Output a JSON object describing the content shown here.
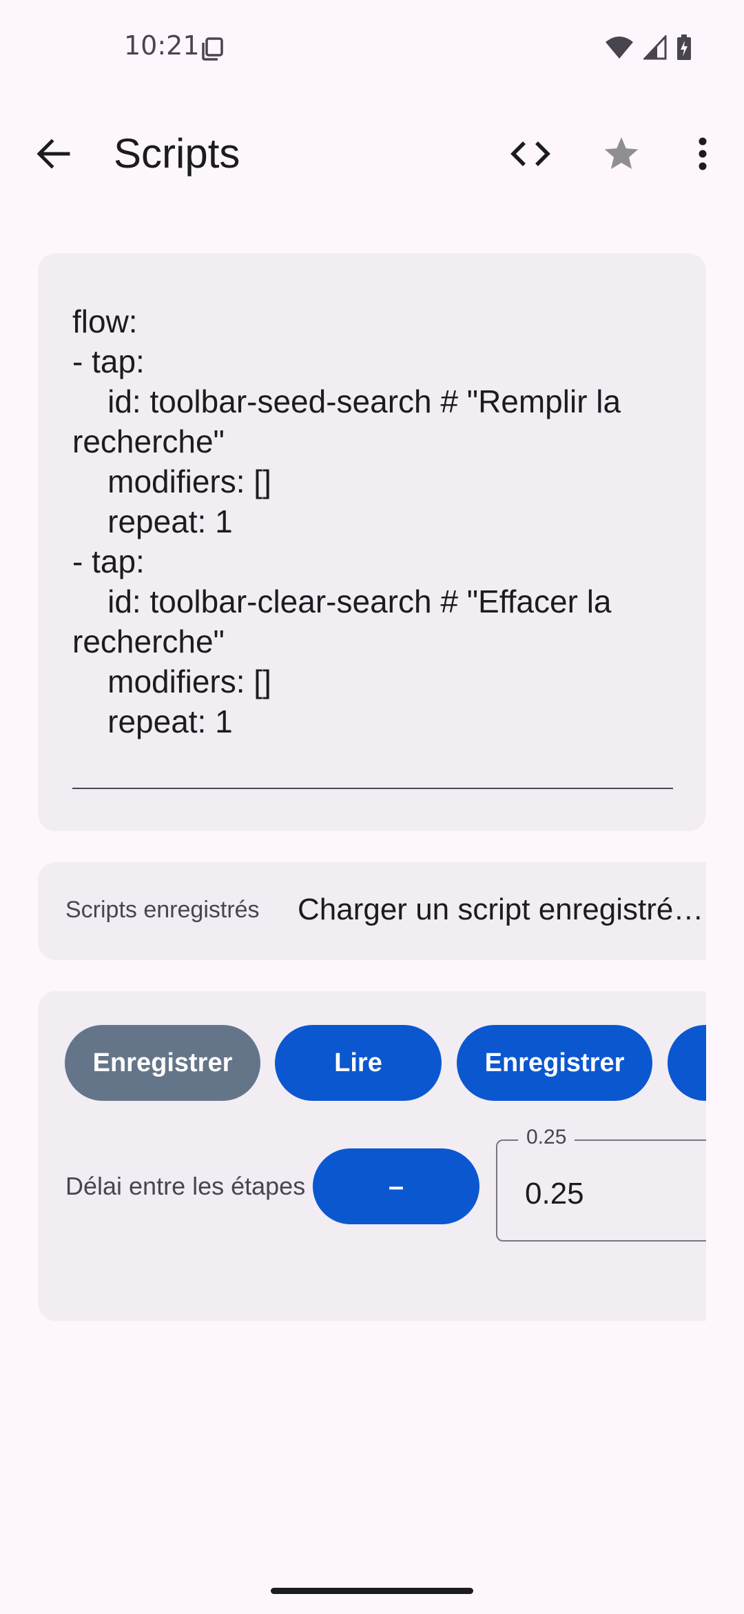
{
  "status_bar": {
    "time": "10:21",
    "icons": [
      "notification-copy-icon",
      "wifi-icon",
      "signal-icon",
      "battery-charging-icon"
    ]
  },
  "app_bar": {
    "title": "Scripts",
    "back_icon": "arrow-back-icon",
    "code_icon": "code-icon",
    "star_icon": "star-icon",
    "more_icon": "more-vert-icon"
  },
  "editor": {
    "content": "flow:\n- tap:\n    id: toolbar-seed-search # \"Remplir la recherche\"\n    modifiers: []\n    repeat: 1\n- tap:\n    id: toolbar-clear-search # \"Effacer la recherche\"\n    modifiers: []\n    repeat: 1"
  },
  "saved_scripts": {
    "label": "Scripts enregistrés",
    "selected": "Charger un script enregistré…"
  },
  "controls": {
    "buttons": [
      {
        "label": "Enregistrer",
        "state": "disabled"
      },
      {
        "label": "Lire",
        "state": "enabled"
      },
      {
        "label": "Enregistrer",
        "state": "enabled"
      },
      {
        "label": "",
        "state": "enabled"
      }
    ],
    "delay": {
      "label": "Délai entre les étapes",
      "decrement_label": "–",
      "field_label": "0.25",
      "field_value": "0.25"
    }
  },
  "colors": {
    "background": "#fdf7fd",
    "card": "#f1edf3",
    "primary": "#0b57d0",
    "disabled_button": "#657589",
    "text": "#1c1b1f",
    "secondary_text": "#49454f"
  }
}
